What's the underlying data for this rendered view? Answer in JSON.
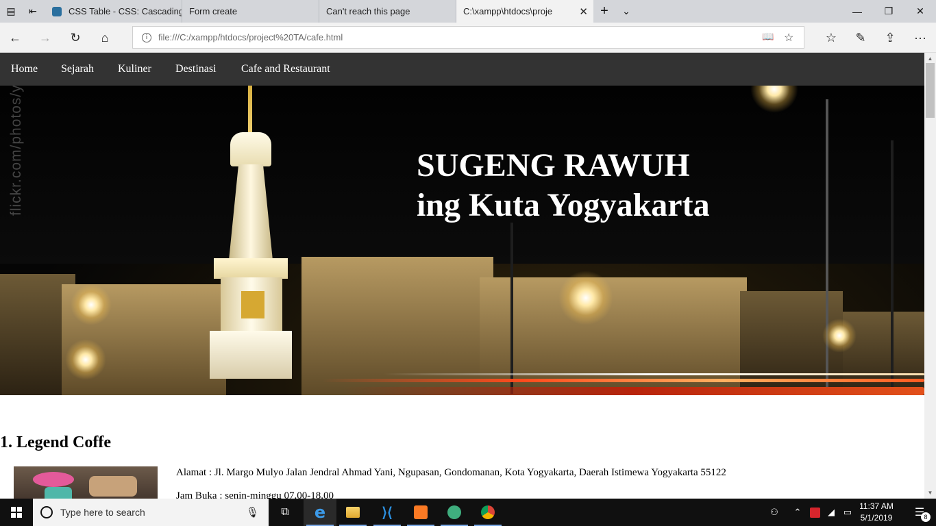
{
  "browser": {
    "tabs": [
      {
        "title": "CSS Table - CSS: Cascading",
        "favicon": "css-favicon",
        "active": false
      },
      {
        "title": "Form create",
        "favicon": "page-icon",
        "active": false
      },
      {
        "title": "Can't reach this page",
        "favicon": "page-icon",
        "active": false
      },
      {
        "title": "C:\\xampp\\htdocs\\proje",
        "favicon": "page-icon",
        "active": true
      }
    ],
    "url": "file:///C:/xampp/htdocs/project%20TA/cafe.html",
    "icons": {
      "back": "←",
      "forward": "→",
      "refresh": "↻",
      "home": "⌂",
      "reading_view": "📖",
      "favorite": "☆",
      "favorites_hub": "☆",
      "notes": "✎",
      "share": "⇪",
      "more": "···",
      "new_tab": "+",
      "tab_list": "⌄",
      "minimize": "—",
      "maximize": "❐",
      "close": "✕",
      "tab_close": "✕"
    }
  },
  "page": {
    "nav": [
      "Home",
      "Sejarah",
      "Kuliner",
      "Destinasi",
      "Cafe and Restaurant"
    ],
    "hero": {
      "title_line1": "SUGENG RAWUH",
      "title_line2": "ing Kuta Yogyakarta",
      "watermark": "flickr.com/photos/y"
    },
    "cafe": {
      "heading": "1. Legend Coffe",
      "address": "Alamat : Jl. Margo Mulyo Jalan Jendral Ahmad Yani, Ngupasan, Gondomanan, Kota Yogyakarta, Daerah Istimewa Yogyakarta 55122",
      "hours": "Jam Buka : senin-minggu 07.00-18.00"
    }
  },
  "taskbar": {
    "search_placeholder": "Type here to search",
    "apps": [
      "task-view-icon",
      "edge-icon",
      "file-explorer-icon",
      "vscode-icon",
      "xampp-icon",
      "atom-icon",
      "chrome-icon"
    ],
    "time": "11:37 AM",
    "date": "5/1/2019",
    "notification_count": "8"
  },
  "colors": {
    "navbar_bg": "#333333",
    "taskbar_bg": "#101010",
    "accent": "#0078d7"
  }
}
